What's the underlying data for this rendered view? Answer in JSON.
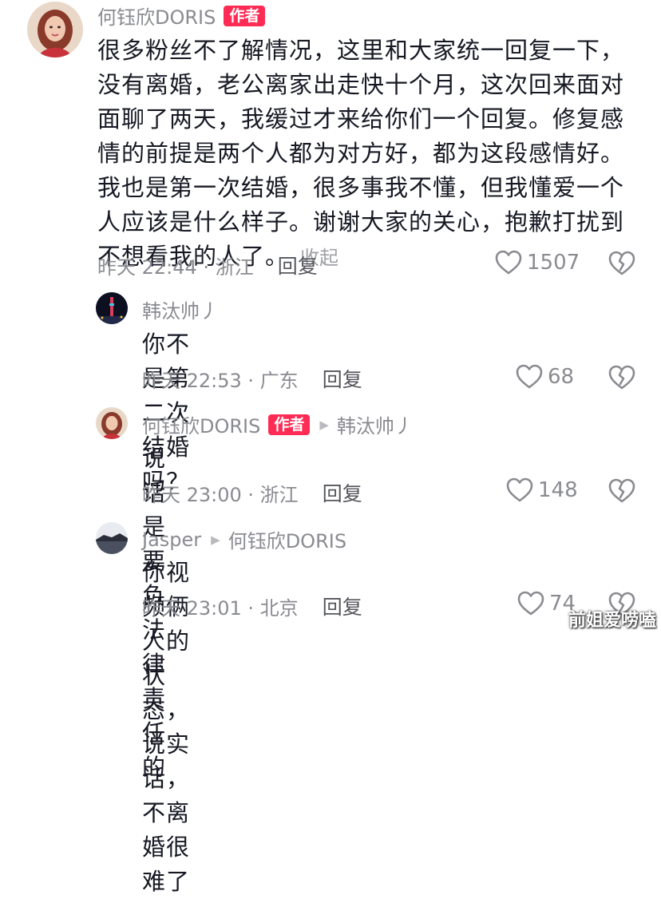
{
  "comments": [
    {
      "username": "何钰欣DORIS",
      "badge": "作者",
      "text_lines": [
        "很多粉丝不了解情况，这里和大家统一回复一下，",
        "没有离婚，老公离家出走快十个月，这次回来面对",
        "面聊了两天，我缓过才来给你们一个回复。修复感",
        "情的前提是两个人都为对方好，都为这段感情好。",
        "我也是第一次结婚，很多事我不懂，但我懂爱一个",
        "人应该是什么样子。谢谢大家的关心，抱歉打扰到",
        "不想看我的人了。"
      ],
      "collapse_label": "收起",
      "time_location": "昨天 22:44 · 浙江",
      "reply_label": "回复",
      "likes": "1507"
    },
    {
      "username": "韩汰帅丿",
      "text": "你不是第二次结婚吗？",
      "time_location": "昨天 22:53 · 广东",
      "reply_label": "回复",
      "likes": "68"
    },
    {
      "username": "何钰欣DORIS",
      "badge": "作者",
      "reply_to": "韩汰帅丿",
      "text": "说话是要负法律责任的",
      "time_location": "昨天 23:00 · 浙江",
      "reply_label": "回复",
      "likes": "148"
    },
    {
      "username": "Jasper",
      "reply_to": "何钰欣DORIS",
      "text": "你视频俩人的状态，说实话，不离婚很难了",
      "time_location": "昨天 23:01 · 北京",
      "reply_label": "回复",
      "likes": "74"
    }
  ],
  "watermark": "前姐爱唠嗑",
  "colors": {
    "badge": "#fe2c55",
    "username": "#8a8b91",
    "text": "#161823",
    "meta": "#8a8b91"
  },
  "icons": [
    "heart-outline-icon",
    "broken-heart-icon",
    "reply-arrow-icon"
  ]
}
